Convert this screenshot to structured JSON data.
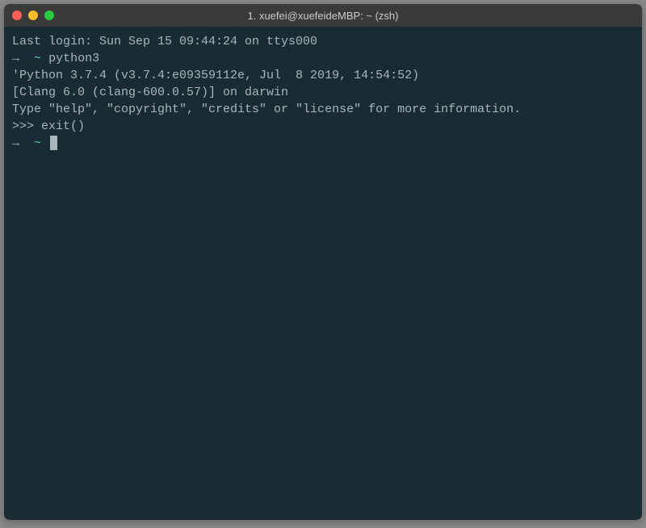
{
  "window": {
    "title": "1. xuefei@xuefeideMBP: ~ (zsh)"
  },
  "terminal": {
    "lastLogin": "Last login: Sun Sep 15 09:44:24 on ttys000",
    "prompt1": {
      "arrow": "→",
      "path": "~",
      "command": "python3"
    },
    "pythonBanner1": "'Python 3.7.4 (v3.7.4:e09359112e, Jul  8 2019, 14:54:52)",
    "pythonBanner2": "[Clang 6.0 (clang-600.0.57)] on darwin",
    "pythonBanner3": "Type \"help\", \"copyright\", \"credits\" or \"license\" for more information.",
    "pyPrompt": ">>> ",
    "pyCommand": "exit()",
    "prompt2": {
      "arrow": "→",
      "path": "~"
    }
  }
}
